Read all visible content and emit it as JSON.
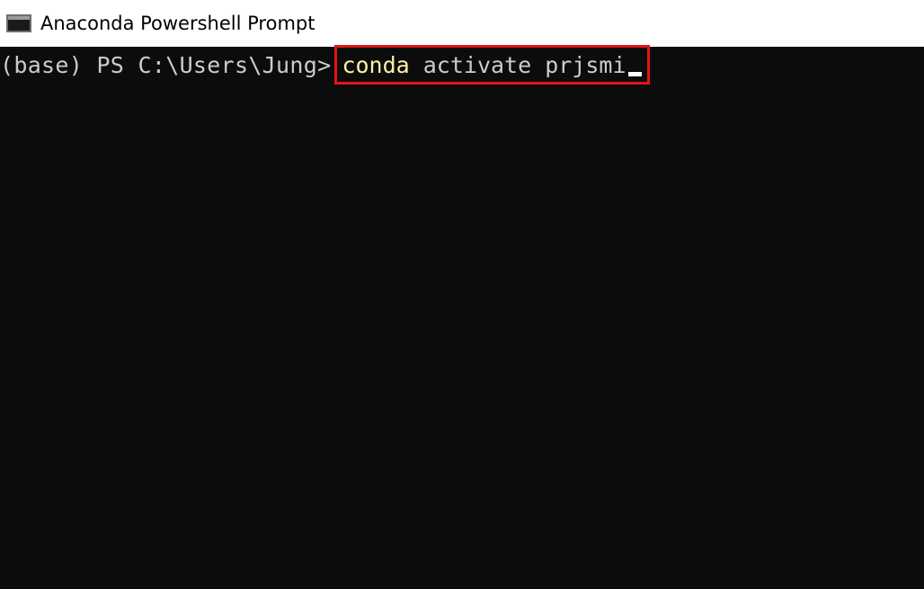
{
  "window": {
    "title": "Anaconda Powershell Prompt",
    "icon": "terminal-icon"
  },
  "console": {
    "prompt": "(base) PS C:\\Users\\Jung>",
    "command_name": "conda",
    "command_args": " activate prjsmi"
  },
  "colors": {
    "background": "#0c0c0c",
    "text": "#cccccc",
    "command_highlight": "#f9f1a5",
    "annotation_box": "#e31414"
  }
}
